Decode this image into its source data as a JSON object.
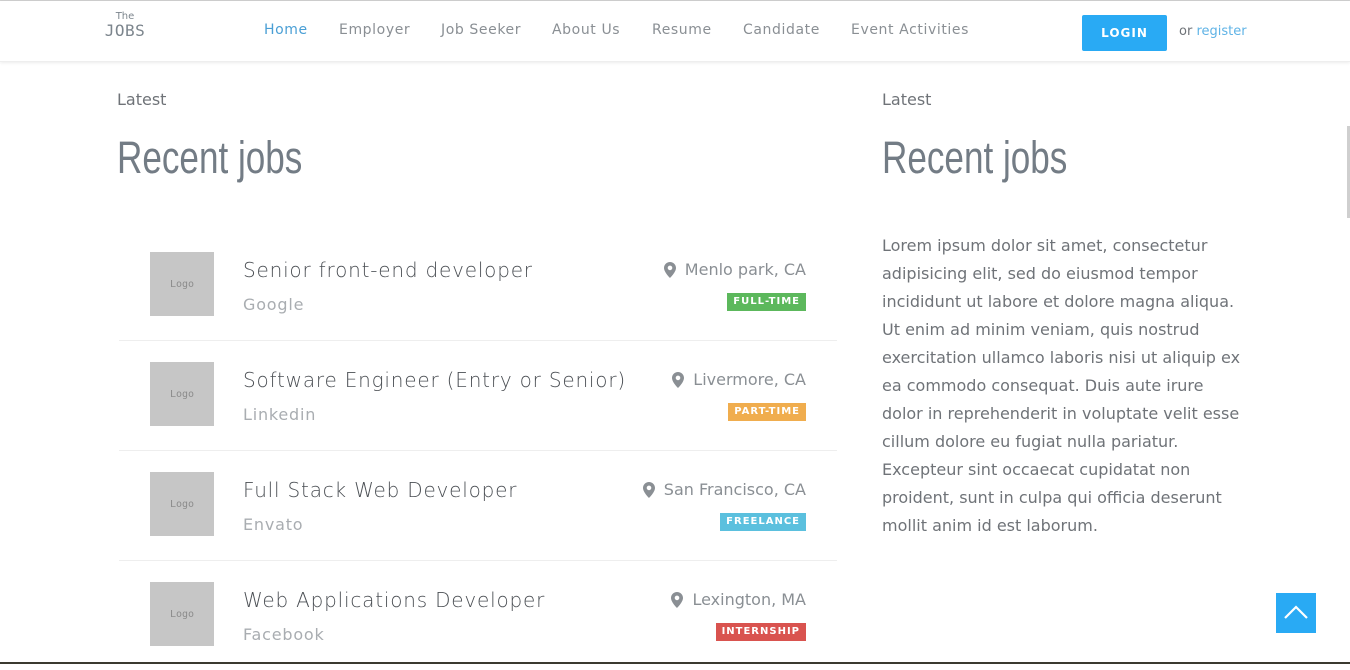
{
  "header": {
    "logo_top": "The",
    "logo_bottom": "JOBS",
    "nav": [
      "Home",
      "Employer",
      "Job Seeker",
      "About Us",
      "Resume",
      "Candidate",
      "Event Activities"
    ],
    "active_nav": "Home",
    "login_label": "LOGIN",
    "or_text": "or",
    "register_label": "register"
  },
  "left_section": {
    "kicker": "Latest",
    "title": "Recent jobs",
    "jobs": [
      {
        "logo": "Logo",
        "title": "Senior front-end developer",
        "company": "Google",
        "location": "Menlo park, CA",
        "type": "FULL-TIME"
      },
      {
        "logo": "Logo",
        "title": "Software Engineer (Entry or Senior)",
        "company": "Linkedin",
        "location": "Livermore, CA",
        "type": "PART-TIME"
      },
      {
        "logo": "Logo",
        "title": "Full Stack Web Developer",
        "company": "Envato",
        "location": "San Francisco, CA",
        "type": "FREELANCE"
      },
      {
        "logo": "Logo",
        "title": "Web Applications Developer",
        "company": "Facebook",
        "location": "Lexington, MA",
        "type": "INTERNSHIP"
      }
    ]
  },
  "right_section": {
    "kicker": "Latest",
    "title": "Recent jobs",
    "body": "Lorem ipsum dolor sit amet, consectetur adipisicing elit, sed do eiusmod tempor incididunt ut labore et dolore magna aliqua. Ut enim ad minim veniam, quis nostrud exercitation ullamco laboris nisi ut aliquip ex ea commodo consequat. Duis aute irure dolor in reprehenderit in voluptate velit esse cillum dolore eu fugiat nulla pariatur. Excepteur sint occaecat cupidatat non proident, sunt in culpa qui officia deserunt mollit anim id est laborum."
  },
  "icons": {
    "location": "map-marker-icon",
    "scroll_top": "chevron-up-icon"
  },
  "colors": {
    "accent": "#29aaf4",
    "full_time": "#5cb85c",
    "part_time": "#f0ad4e",
    "freelance": "#5bc0de",
    "internship": "#d9534f"
  }
}
